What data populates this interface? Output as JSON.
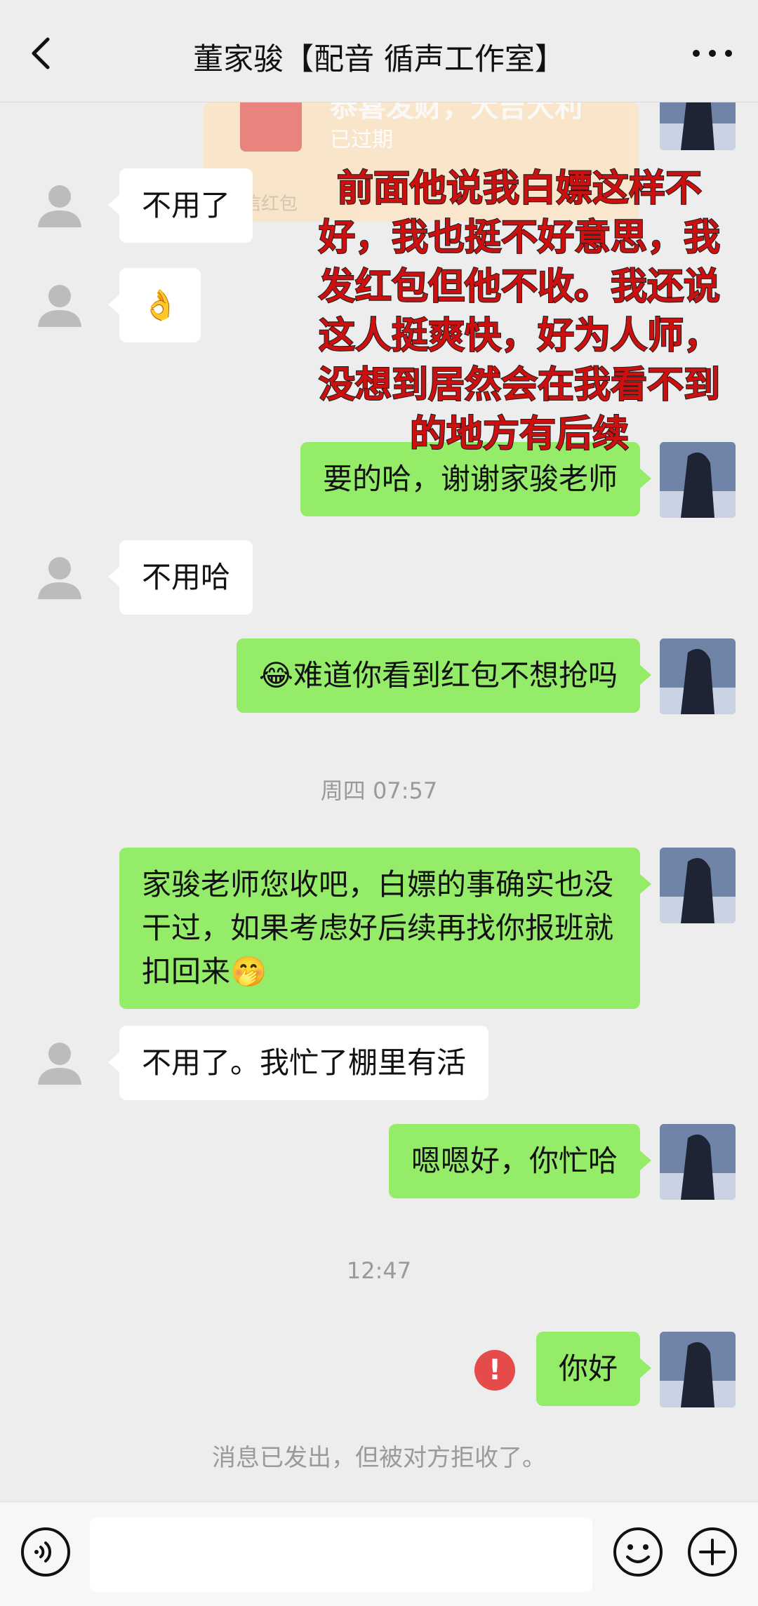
{
  "header": {
    "title": "董家骏【配音 循声工作室】"
  },
  "red_packet": {
    "title": "恭喜发财，大吉大利",
    "status": "已过期",
    "footer": "微信红包"
  },
  "overlay_text": "前面他说我白嫖这样不好，我也挺不好意思，我发红包但他不收。我还说这人挺爽快，好为人师，没想到居然会在我看不到的地方有后续",
  "messages": {
    "m1": "不用了",
    "m2": "👌",
    "m3": "要的哈，谢谢家骏老师",
    "m4": "不用哈",
    "m5": "😂难道你看到红包不想抢吗",
    "m6": "家骏老师您收吧，白嫖的事确实也没干过，如果考虑好后续再找你报班就扣回来🤭",
    "m7": "不用了。我忙了棚里有活",
    "m8": "嗯嗯好，你忙哈",
    "m9": "你好"
  },
  "times": {
    "t1": "周四 07:57",
    "t2": "12:47"
  },
  "error_icon": "!",
  "system_notice": "消息已发出，但被对方拒收了。",
  "colors": {
    "background": "#ededed",
    "sent_bubble": "#95ec69",
    "received_bubble": "#ffffff",
    "overlay_text": "#cc1010",
    "error": "#e64b4b"
  }
}
